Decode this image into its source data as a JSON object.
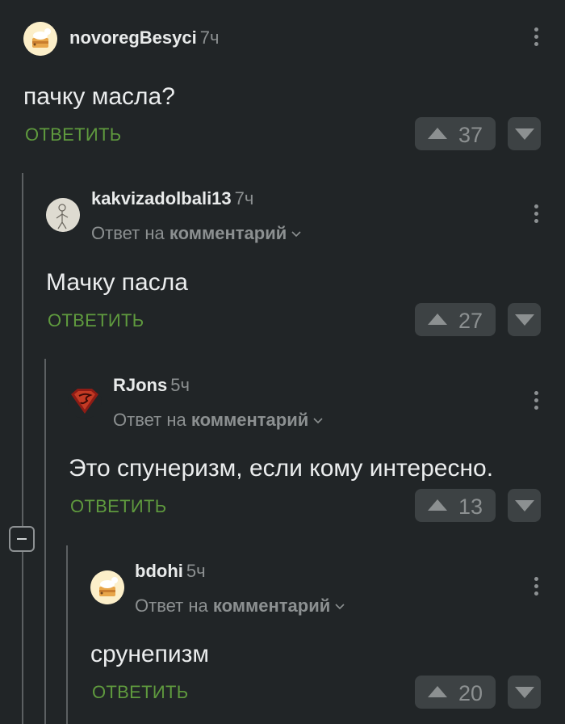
{
  "colors": {
    "background": "#212527",
    "reply_link": "#5f9a3e",
    "vote_box": "#3d4244",
    "muted_text": "#8c9091"
  },
  "comments": [
    {
      "username": "novoregBesyci",
      "time": "7ч",
      "body": "пачку масла?",
      "reply_label": "ОТВЕТИТЬ",
      "rating": "37",
      "avatar": "cake-avatar"
    },
    {
      "username": "kakvizadolbali13",
      "time": "7ч",
      "reply_to_prefix": "Ответ на",
      "reply_to_target": "комментарий",
      "body": "Мачку пасла",
      "reply_label": "ОТВЕТИТЬ",
      "rating": "27",
      "avatar": "sketch-avatar"
    },
    {
      "username": "RJons",
      "time": "5ч",
      "reply_to_prefix": "Ответ на",
      "reply_to_target": "комментарий",
      "body": "Это спунеризм, если кому интересно.",
      "reply_label": "ОТВЕТИТЬ",
      "rating": "13",
      "avatar": "superman-avatar"
    },
    {
      "username": "bdohi",
      "time": "5ч",
      "reply_to_prefix": "Ответ на",
      "reply_to_target": "комментарий",
      "body": "срунепизм",
      "reply_label": "ОТВЕТИТЬ",
      "rating": "20",
      "avatar": "cake-avatar"
    }
  ]
}
